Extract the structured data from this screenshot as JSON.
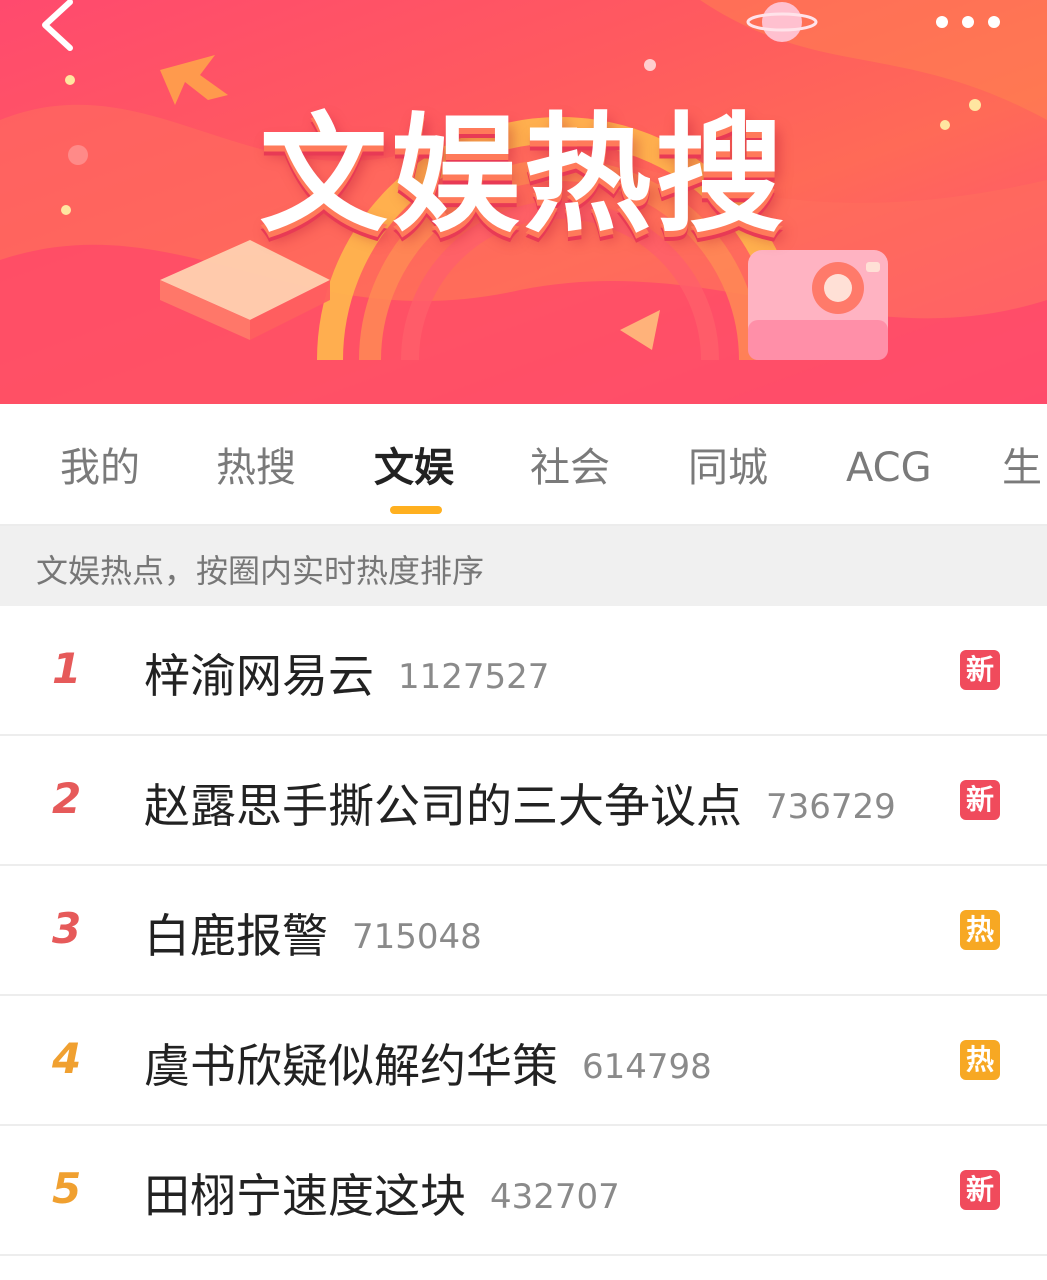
{
  "banner": {
    "title": "文娱热搜"
  },
  "tabs": [
    {
      "label": "我的",
      "active": false
    },
    {
      "label": "热搜",
      "active": false
    },
    {
      "label": "文娱",
      "active": true
    },
    {
      "label": "社会",
      "active": false
    },
    {
      "label": "同城",
      "active": false
    },
    {
      "label": "ACG",
      "active": false
    },
    {
      "label": "生",
      "active": false
    }
  ],
  "subheader": "文娱热点，按圈内实时热度排序",
  "colors": {
    "rank_top3": "#e65a5a",
    "rank_rest": "#f0a030",
    "badge_new": "#f04b5c",
    "badge_hot": "#f7a823",
    "tab_indicator": "#ffb020"
  },
  "list": [
    {
      "rank": "1",
      "title": "梓渝网易云",
      "count": "1127527",
      "badge": "新",
      "badge_type": "new"
    },
    {
      "rank": "2",
      "title": "赵露思手撕公司的三大争议点",
      "count": "736729",
      "badge": "新",
      "badge_type": "new"
    },
    {
      "rank": "3",
      "title": "白鹿报警",
      "count": "715048",
      "badge": "热",
      "badge_type": "hot"
    },
    {
      "rank": "4",
      "title": "虞书欣疑似解约华策",
      "count": "614798",
      "badge": "热",
      "badge_type": "hot"
    },
    {
      "rank": "5",
      "title": "田栩宁速度这块",
      "count": "432707",
      "badge": "新",
      "badge_type": "new"
    }
  ]
}
